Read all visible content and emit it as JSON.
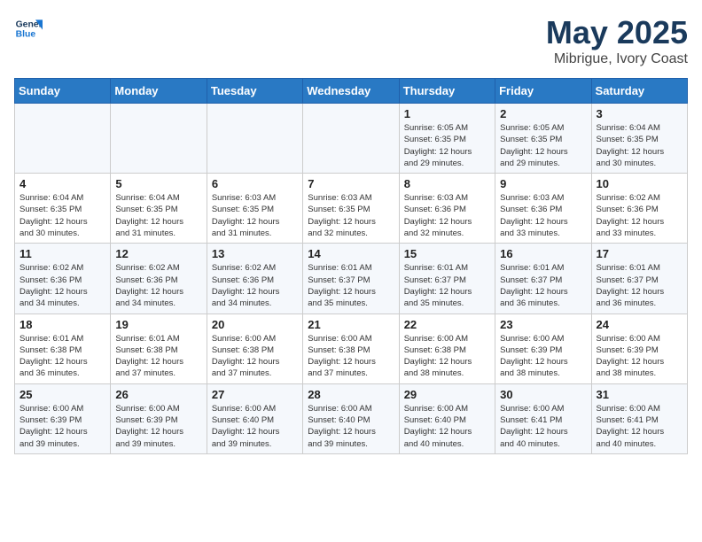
{
  "header": {
    "logo_general": "General",
    "logo_blue": "Blue",
    "month": "May 2025",
    "location": "Mibrigue, Ivory Coast"
  },
  "weekdays": [
    "Sunday",
    "Monday",
    "Tuesday",
    "Wednesday",
    "Thursday",
    "Friday",
    "Saturday"
  ],
  "weeks": [
    [
      {
        "day": "",
        "info": ""
      },
      {
        "day": "",
        "info": ""
      },
      {
        "day": "",
        "info": ""
      },
      {
        "day": "",
        "info": ""
      },
      {
        "day": "1",
        "info": "Sunrise: 6:05 AM\nSunset: 6:35 PM\nDaylight: 12 hours\nand 29 minutes."
      },
      {
        "day": "2",
        "info": "Sunrise: 6:05 AM\nSunset: 6:35 PM\nDaylight: 12 hours\nand 29 minutes."
      },
      {
        "day": "3",
        "info": "Sunrise: 6:04 AM\nSunset: 6:35 PM\nDaylight: 12 hours\nand 30 minutes."
      }
    ],
    [
      {
        "day": "4",
        "info": "Sunrise: 6:04 AM\nSunset: 6:35 PM\nDaylight: 12 hours\nand 30 minutes."
      },
      {
        "day": "5",
        "info": "Sunrise: 6:04 AM\nSunset: 6:35 PM\nDaylight: 12 hours\nand 31 minutes."
      },
      {
        "day": "6",
        "info": "Sunrise: 6:03 AM\nSunset: 6:35 PM\nDaylight: 12 hours\nand 31 minutes."
      },
      {
        "day": "7",
        "info": "Sunrise: 6:03 AM\nSunset: 6:35 PM\nDaylight: 12 hours\nand 32 minutes."
      },
      {
        "day": "8",
        "info": "Sunrise: 6:03 AM\nSunset: 6:36 PM\nDaylight: 12 hours\nand 32 minutes."
      },
      {
        "day": "9",
        "info": "Sunrise: 6:03 AM\nSunset: 6:36 PM\nDaylight: 12 hours\nand 33 minutes."
      },
      {
        "day": "10",
        "info": "Sunrise: 6:02 AM\nSunset: 6:36 PM\nDaylight: 12 hours\nand 33 minutes."
      }
    ],
    [
      {
        "day": "11",
        "info": "Sunrise: 6:02 AM\nSunset: 6:36 PM\nDaylight: 12 hours\nand 34 minutes."
      },
      {
        "day": "12",
        "info": "Sunrise: 6:02 AM\nSunset: 6:36 PM\nDaylight: 12 hours\nand 34 minutes."
      },
      {
        "day": "13",
        "info": "Sunrise: 6:02 AM\nSunset: 6:36 PM\nDaylight: 12 hours\nand 34 minutes."
      },
      {
        "day": "14",
        "info": "Sunrise: 6:01 AM\nSunset: 6:37 PM\nDaylight: 12 hours\nand 35 minutes."
      },
      {
        "day": "15",
        "info": "Sunrise: 6:01 AM\nSunset: 6:37 PM\nDaylight: 12 hours\nand 35 minutes."
      },
      {
        "day": "16",
        "info": "Sunrise: 6:01 AM\nSunset: 6:37 PM\nDaylight: 12 hours\nand 36 minutes."
      },
      {
        "day": "17",
        "info": "Sunrise: 6:01 AM\nSunset: 6:37 PM\nDaylight: 12 hours\nand 36 minutes."
      }
    ],
    [
      {
        "day": "18",
        "info": "Sunrise: 6:01 AM\nSunset: 6:38 PM\nDaylight: 12 hours\nand 36 minutes."
      },
      {
        "day": "19",
        "info": "Sunrise: 6:01 AM\nSunset: 6:38 PM\nDaylight: 12 hours\nand 37 minutes."
      },
      {
        "day": "20",
        "info": "Sunrise: 6:00 AM\nSunset: 6:38 PM\nDaylight: 12 hours\nand 37 minutes."
      },
      {
        "day": "21",
        "info": "Sunrise: 6:00 AM\nSunset: 6:38 PM\nDaylight: 12 hours\nand 37 minutes."
      },
      {
        "day": "22",
        "info": "Sunrise: 6:00 AM\nSunset: 6:38 PM\nDaylight: 12 hours\nand 38 minutes."
      },
      {
        "day": "23",
        "info": "Sunrise: 6:00 AM\nSunset: 6:39 PM\nDaylight: 12 hours\nand 38 minutes."
      },
      {
        "day": "24",
        "info": "Sunrise: 6:00 AM\nSunset: 6:39 PM\nDaylight: 12 hours\nand 38 minutes."
      }
    ],
    [
      {
        "day": "25",
        "info": "Sunrise: 6:00 AM\nSunset: 6:39 PM\nDaylight: 12 hours\nand 39 minutes."
      },
      {
        "day": "26",
        "info": "Sunrise: 6:00 AM\nSunset: 6:39 PM\nDaylight: 12 hours\nand 39 minutes."
      },
      {
        "day": "27",
        "info": "Sunrise: 6:00 AM\nSunset: 6:40 PM\nDaylight: 12 hours\nand 39 minutes."
      },
      {
        "day": "28",
        "info": "Sunrise: 6:00 AM\nSunset: 6:40 PM\nDaylight: 12 hours\nand 39 minutes."
      },
      {
        "day": "29",
        "info": "Sunrise: 6:00 AM\nSunset: 6:40 PM\nDaylight: 12 hours\nand 40 minutes."
      },
      {
        "day": "30",
        "info": "Sunrise: 6:00 AM\nSunset: 6:41 PM\nDaylight: 12 hours\nand 40 minutes."
      },
      {
        "day": "31",
        "info": "Sunrise: 6:00 AM\nSunset: 6:41 PM\nDaylight: 12 hours\nand 40 minutes."
      }
    ]
  ]
}
